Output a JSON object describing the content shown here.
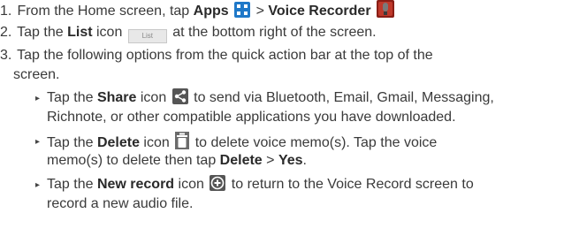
{
  "steps": [
    {
      "num": "1.",
      "pre": "From the Home screen, tap",
      "apps_label": "Apps",
      "sep": ">",
      "voice_recorder_label": "Voice Recorder"
    },
    {
      "num": "2.",
      "pre": "Tap the",
      "list_label": "List",
      "mid": "icon",
      "list_icon_text": "List",
      "post": "at the bottom right of the screen."
    },
    {
      "num": "3.",
      "line1": "Tap the following options from the quick action bar at the top of the",
      "line2": "screen."
    }
  ],
  "bullets": [
    {
      "pre": "Tap the",
      "label": "Share",
      "mid": "icon",
      "post": "to send via Bluetooth, Email, Gmail, Messaging,",
      "line2": "Richnote, or other compatible applications you have downloaded."
    },
    {
      "pre": "Tap the",
      "label": "Delete",
      "mid": "icon",
      "post": "to delete voice memo(s). Tap the voice",
      "line2_pre": "memo(s) to delete then tap",
      "line2_delete": "Delete",
      "line2_sep": ">",
      "line2_yes": "Yes",
      "line2_end": "."
    },
    {
      "pre": "Tap the",
      "label": "New record",
      "mid": "icon",
      "post": "to return to the Voice Record screen to",
      "line2": "record a new audio file."
    }
  ],
  "bullet_glyph": "▸",
  "icons": {
    "apps": "apps-grid-icon",
    "voice_recorder": "voice-recorder-icon",
    "list": "list-icon",
    "share": "share-icon",
    "delete": "trash-icon",
    "new_record": "plus-circle-icon"
  },
  "colors": {
    "text": "#3a3a3a",
    "apps_icon": "#1f78c8",
    "voice_recorder_icon": "#c0392b",
    "share_icon": "#555555",
    "delete_icon": "#6b6b6b",
    "new_record_icon": "#555555"
  }
}
